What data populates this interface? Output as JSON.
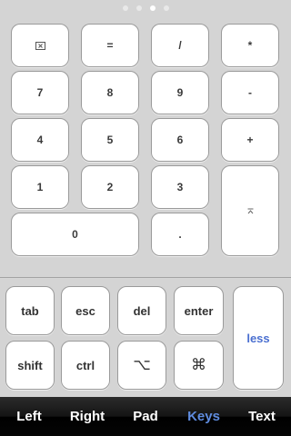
{
  "page_indicator": {
    "count": 4,
    "active_index": 2
  },
  "numpad": {
    "backspace_icon": "delete-box-icon",
    "equals": "=",
    "divide": "/",
    "multiply": "*",
    "seven": "7",
    "eight": "8",
    "nine": "9",
    "minus": "-",
    "four": "4",
    "five": "5",
    "six": "6",
    "plus": "+",
    "one": "1",
    "two": "2",
    "three": "3",
    "enter_icon": "enter-arrow-icon",
    "zero": "0",
    "decimal": "."
  },
  "keyboard": {
    "tab": "tab",
    "esc": "esc",
    "del": "del",
    "enter": "enter",
    "less": "less",
    "shift": "shift",
    "ctrl": "ctrl",
    "option": "⌥",
    "command": "⌘"
  },
  "tabbar": {
    "items": [
      {
        "label": "Left"
      },
      {
        "label": "Right"
      },
      {
        "label": "Pad"
      },
      {
        "label": "Keys"
      },
      {
        "label": "Text"
      }
    ],
    "active": "Keys"
  },
  "colors": {
    "background": "#d4d4d4",
    "key": "#ffffff",
    "accent": "#5f8cdf",
    "tabbar": "#000000"
  }
}
